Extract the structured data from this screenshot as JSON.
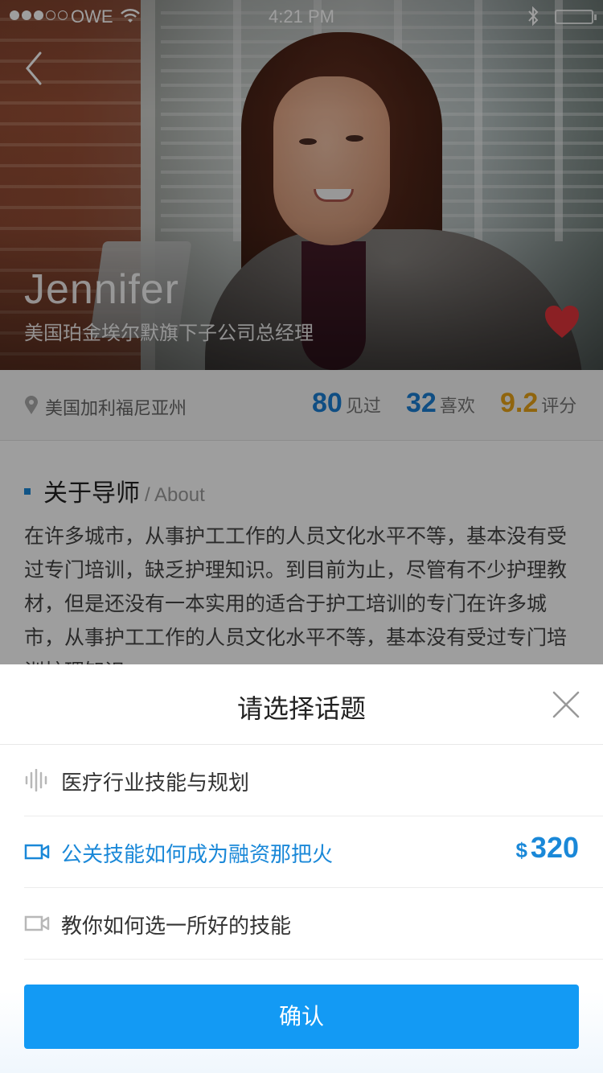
{
  "status_bar": {
    "carrier": "OWE",
    "time": "4:21 PM"
  },
  "profile": {
    "name": "Jennifer",
    "title": "美国珀金埃尔默旗下子公司总经理",
    "location": "美国加利福尼亚州",
    "stats": [
      {
        "value": "80",
        "label": "见过",
        "color": "#1a7fd4"
      },
      {
        "value": "32",
        "label": "喜欢",
        "color": "#1a7fd4"
      },
      {
        "value": "9.2",
        "label": "评分",
        "color": "#e8a317"
      }
    ]
  },
  "about": {
    "title": "关于导师",
    "subtitle": "/ About",
    "text": "在许多城市，从事护工工作的人员文化水平不等，基本没有受过专门培训，缺乏护理知识。到目前为止，尽管有不少护理教材，但是还没有一本实用的适合于护工培训的专门在许多城市，从事护工工作的人员文化水平不等，基本没有受过专门培训护理知识"
  },
  "sheet": {
    "title": "请选择话题",
    "topics": [
      {
        "label": "医疗行业技能与规划",
        "icon": "audio-wave-icon",
        "active": false
      },
      {
        "label": "公关技能如何成为融资那把火",
        "icon": "video-camera-icon",
        "active": true,
        "price_symbol": "$",
        "price": "320"
      },
      {
        "label": "教你如何选一所好的技能",
        "icon": "video-camera-icon",
        "active": false
      }
    ],
    "confirm_label": "确认"
  },
  "colors": {
    "accent": "#139af4",
    "link_blue": "#1a88d8",
    "rating_orange": "#e8a317",
    "heart_red": "#e0353a"
  }
}
